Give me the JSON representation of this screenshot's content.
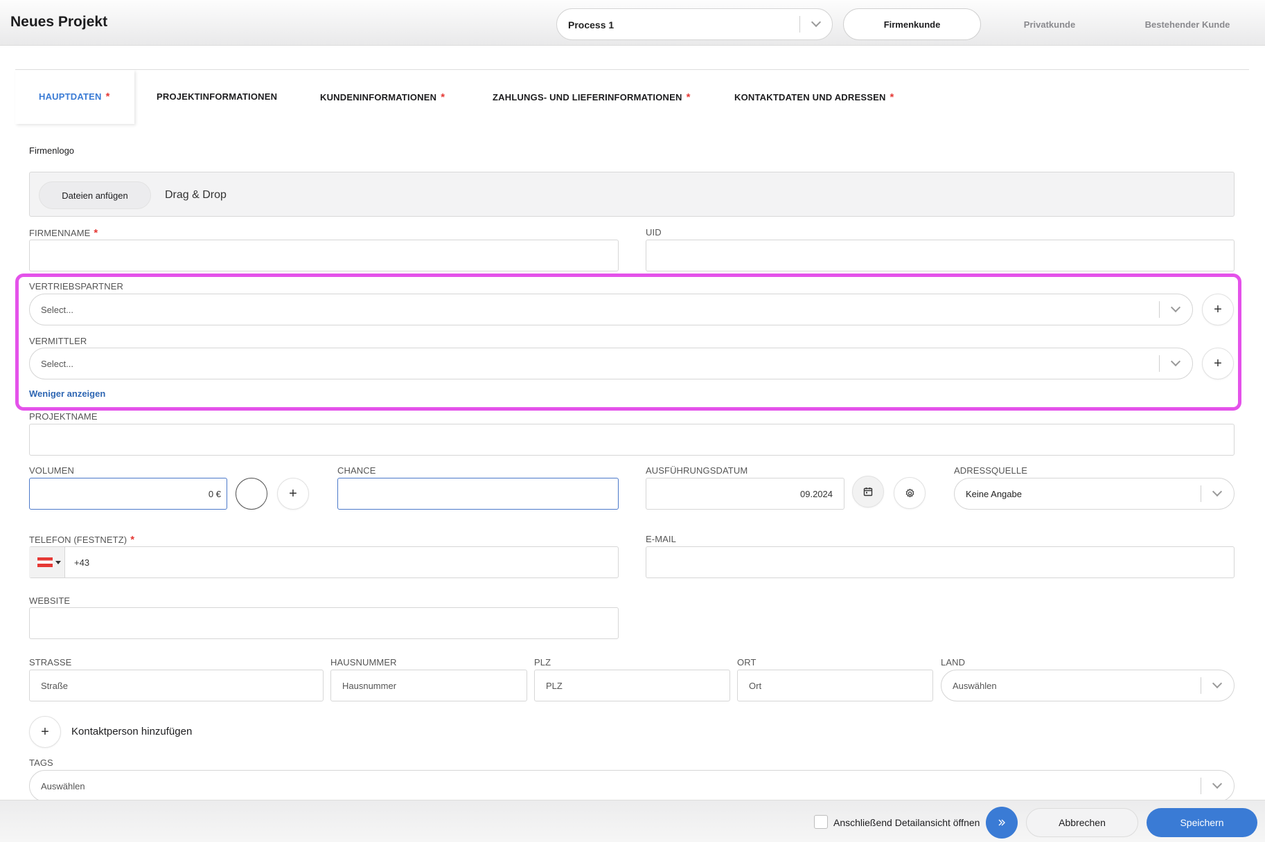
{
  "header": {
    "title": "Neues Projekt",
    "process_value": "Process 1",
    "segments": [
      "Firmenkunde",
      "Privatkunde",
      "Bestehender Kunde"
    ]
  },
  "tabs": [
    {
      "label": "HAUPTDATEN",
      "required": "*"
    },
    {
      "label": "PROJEKTINFORMATIONEN",
      "required": ""
    },
    {
      "label": "KUNDENINFORMATIONEN",
      "required": "*"
    },
    {
      "label": "ZAHLUNGS- UND LIEFERINFORMATIONEN",
      "required": "*"
    },
    {
      "label": "KONTAKTDATEN UND ADRESSEN",
      "required": "*"
    }
  ],
  "form": {
    "firmenlogo_label": "Firmenlogo",
    "attach_button": "Dateien anfügen",
    "drag_drop": "Drag & Drop",
    "firmenname_label": "FIRMENNAME",
    "uid_label": "UID",
    "vertriebspartner_label": "VERTRIEBSPARTNER",
    "vertriebspartner_placeholder": "Select...",
    "vermittler_label": "VERMITTLER",
    "vermittler_placeholder": "Select...",
    "weniger_link": "Weniger anzeigen",
    "projektname_label": "PROJEKTNAME",
    "volumen_label": "VOLUMEN",
    "volumen_value": "0 €",
    "chance_label": "CHANCE",
    "ausfuehrungsdatum_label": "AUSFÜHRUNGSDATUM",
    "ausfuehrungsdatum_value": "09.2024",
    "adressquelle_label": "ADRESSQUELLE",
    "adressquelle_value": "Keine Angabe",
    "telefon_label": "TELEFON (FESTNETZ)",
    "telefon_value": "+43",
    "email_label": "E-MAIL",
    "website_label": "WEBSITE",
    "strasse_label": "STRASSE",
    "strasse_placeholder": "Straße",
    "hausnummer_label": "HAUSNUMMER",
    "hausnummer_placeholder": "Hausnummer",
    "plz_label": "PLZ",
    "plz_placeholder": "PLZ",
    "ort_label": "ORT",
    "ort_placeholder": "Ort",
    "land_label": "LAND",
    "land_placeholder": "Auswählen",
    "add_contact_label": "Kontaktperson hinzufügen",
    "tags_label": "TAGS",
    "tags_placeholder": "Auswählen",
    "required_mark": "*",
    "plus": "+"
  },
  "footer": {
    "checkbox_label": "Anschließend Detailansicht öffnen",
    "cancel": "Abbrechen",
    "save": "Speichern"
  },
  "colors": {
    "accent": "#3a7bd5",
    "required": "#e53935",
    "highlight": "#e452ea"
  },
  "icons": [
    "chevron-down-icon",
    "plus-icon",
    "calendar-icon",
    "gear-icon",
    "double-chevron-right-icon",
    "austria-flag-icon"
  ]
}
